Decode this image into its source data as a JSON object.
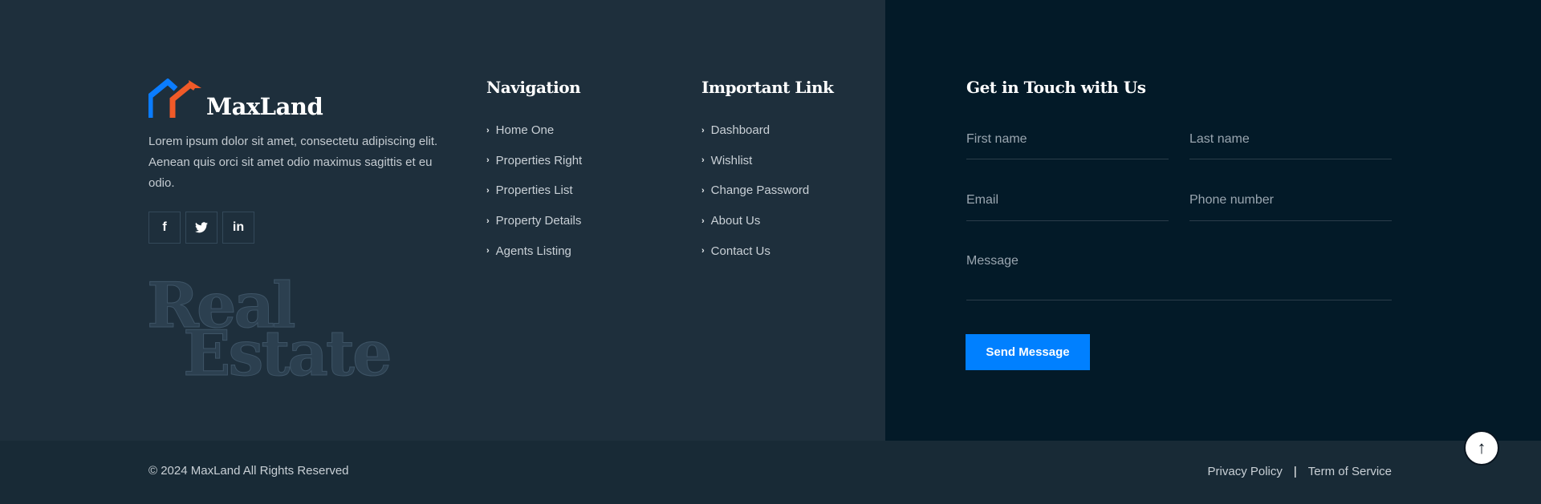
{
  "brand": {
    "name": "MaxLand",
    "colors": {
      "primary": "#0a7cff",
      "secondary": "#f05a28"
    }
  },
  "about": "Lorem ipsum dolor sit amet, consectetu adipiscing elit. Aenean quis orci sit amet odio maximus sagittis et eu odio.",
  "socials": [
    {
      "icon": "facebook-icon",
      "glyph": "f"
    },
    {
      "icon": "twitter-icon",
      "glyph": "🐦"
    },
    {
      "icon": "linkedin-icon",
      "glyph": "in"
    }
  ],
  "watermark": {
    "line1": "Real",
    "line2": "Estate"
  },
  "navigation": {
    "title": "Navigation",
    "items": [
      "Home One",
      "Properties Right",
      "Properties List",
      "Property Details",
      "Agents Listing"
    ]
  },
  "important": {
    "title": "Important Link",
    "items": [
      "Dashboard",
      "Wishlist",
      "Change Password",
      "About Us",
      "Contact Us"
    ]
  },
  "contact": {
    "title": "Get in Touch with Us",
    "first_name": "First name",
    "last_name": "Last name",
    "email": "Email",
    "phone": "Phone number",
    "message": "Message",
    "send": "Send Message"
  },
  "footer": {
    "copyright": "© 2024 MaxLand All Rights Reserved",
    "privacy": "Privacy Policy",
    "separator": "|",
    "terms": "Term of Service"
  },
  "accent": "#0080ff"
}
